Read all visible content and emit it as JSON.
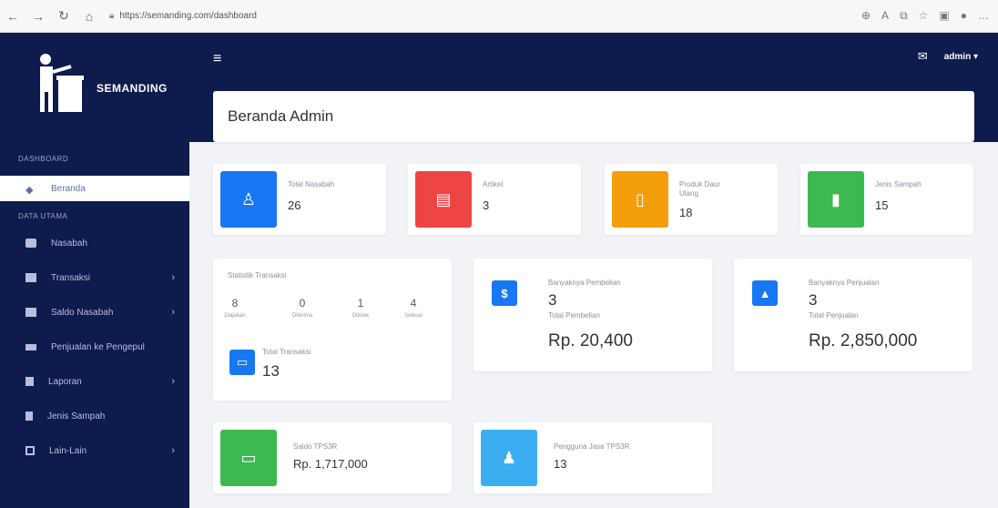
{
  "browser": {
    "url": "https://semanding.com/dashboard"
  },
  "brand": {
    "name": "SEMANDING"
  },
  "sidebar": {
    "section_dashboard": "DASHBOARD",
    "item_beranda": "Beranda",
    "section_main": "DATA UTAMA",
    "items": [
      {
        "label": "Nasabah",
        "icon": "users-icon",
        "chevron": false
      },
      {
        "label": "Transaksi",
        "icon": "list-icon",
        "chevron": true
      },
      {
        "label": "Saldo Nasabah",
        "icon": "card-icon",
        "chevron": true
      },
      {
        "label": "Penjualan ke Pengepul",
        "icon": "chart-icon",
        "chevron": false
      },
      {
        "label": "Laporan",
        "icon": "book-icon",
        "chevron": true
      },
      {
        "label": "Jenis Sampah",
        "icon": "trash-icon",
        "chevron": false
      },
      {
        "label": "Lain-Lain",
        "icon": "box-icon",
        "chevron": true
      }
    ]
  },
  "topbar": {
    "user": "admin"
  },
  "header": {
    "title": "Beranda Admin"
  },
  "stats": [
    {
      "label": "Total Nasabah",
      "value": "26",
      "color": "#1877f2",
      "icon": "user-icon"
    },
    {
      "label": "Artikel",
      "value": "3",
      "color": "#ef4444",
      "icon": "newspaper-icon"
    },
    {
      "label": "Produk Daur Ulang",
      "value": "18",
      "color": "#f59e0b",
      "icon": "file-icon"
    },
    {
      "label": "Jenis Sampah",
      "value": "15",
      "color": "#3cb950",
      "icon": "trash-icon"
    }
  ],
  "transaksi": {
    "title": "Statistik Transaksi",
    "cols": [
      {
        "n": "8",
        "l": "Diajukan"
      },
      {
        "n": "0",
        "l": "Diterima"
      },
      {
        "n": "1",
        "l": "Ditolak"
      },
      {
        "n": "4",
        "l": "Selesai"
      }
    ],
    "total_label": "Total Transaksi",
    "total_value": "13"
  },
  "pembelian": {
    "label": "Banyaknya Pembelian",
    "count": "3",
    "total_label": "Total Pembelian",
    "total": "Rp. 20,400"
  },
  "penjualan": {
    "label": "Banyaknya Penjualan",
    "count": "3",
    "total_label": "Total Penjualan",
    "total": "Rp. 2,850,000"
  },
  "saldo": {
    "label": "Saldo TPS3R",
    "value": "Rp. 1,717,000"
  },
  "pengguna": {
    "label": "Pengguna Jasa TPS3R",
    "value": "13"
  }
}
